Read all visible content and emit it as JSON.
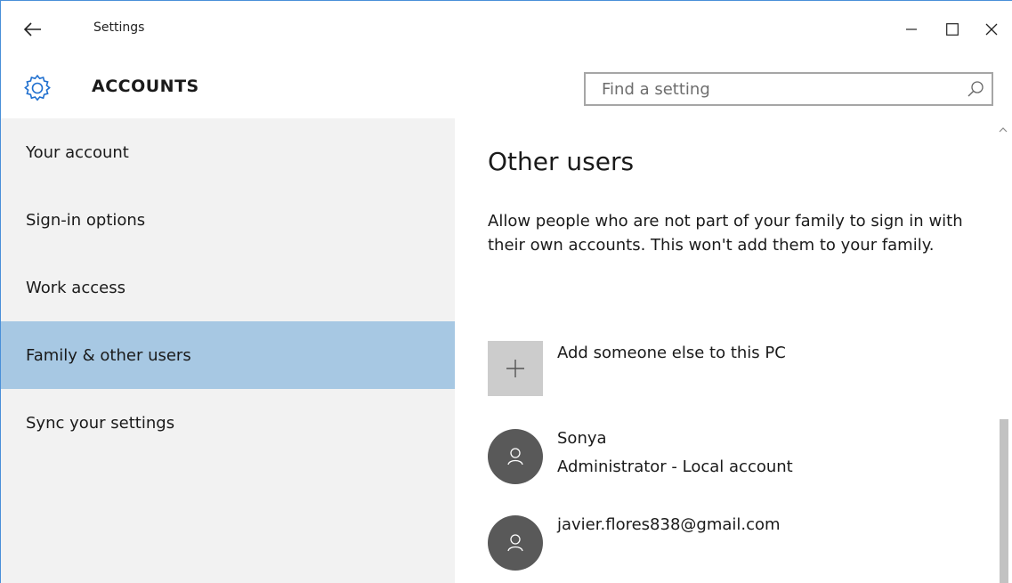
{
  "window": {
    "title": "Settings",
    "back_icon": "back-arrow-icon",
    "controls": [
      "minimize-icon",
      "maximize-icon",
      "close-icon"
    ]
  },
  "header": {
    "icon": "gear-icon",
    "heading": "ACCOUNTS",
    "search_placeholder": "Find a setting",
    "search_icon": "search-icon"
  },
  "sidebar": {
    "items": [
      {
        "label": "Your account",
        "active": false
      },
      {
        "label": "Sign-in options",
        "active": false
      },
      {
        "label": "Work access",
        "active": false
      },
      {
        "label": "Family & other users",
        "active": true
      },
      {
        "label": "Sync your settings",
        "active": false
      }
    ],
    "active_color": "#a7c8e3",
    "background_color": "#f2f2f2"
  },
  "main": {
    "title": "Other users",
    "description": "Allow people who are not part of your family to sign in with their own accounts. This won't add them to your family.",
    "add_user_label": "Add someone else to this PC",
    "users": [
      {
        "name": "Sonya",
        "detail": "Administrator - Local account"
      },
      {
        "name": "javier.flores838@gmail.com",
        "detail": ""
      }
    ]
  }
}
